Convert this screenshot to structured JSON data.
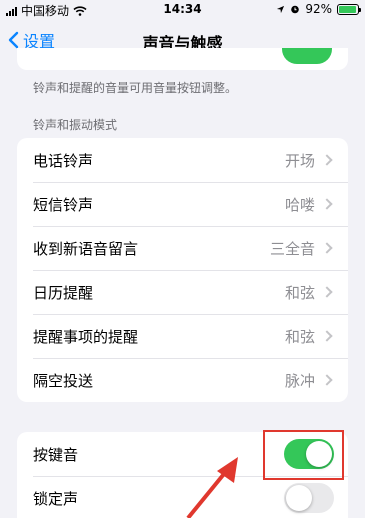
{
  "status_bar": {
    "carrier": "中国移动",
    "time": "14:34",
    "battery_percent": "92%",
    "battery_level": 0.92,
    "icons": [
      "signal-icon",
      "wifi-icon",
      "location-icon",
      "alarm-icon",
      "battery-icon"
    ]
  },
  "nav": {
    "back_label": "设置",
    "title": "声音与触感"
  },
  "footnote": "铃声和提醒的音量可用音量按钮调整。",
  "ringtones_section": {
    "header": "铃声和振动模式",
    "rows": [
      {
        "label": "电话铃声",
        "value": "开场"
      },
      {
        "label": "短信铃声",
        "value": "哈喽"
      },
      {
        "label": "收到新语音留言",
        "value": "三全音"
      },
      {
        "label": "日历提醒",
        "value": "和弦"
      },
      {
        "label": "提醒事项的提醒",
        "value": "和弦"
      },
      {
        "label": "隔空投送",
        "value": "脉冲"
      }
    ]
  },
  "switches_section": {
    "rows": [
      {
        "label": "按键音",
        "on": true
      },
      {
        "label": "锁定声",
        "on": false
      }
    ]
  },
  "colors": {
    "accent": "#0a84ff",
    "toggle_on": "#34c759",
    "annotation": "#e0382e"
  }
}
